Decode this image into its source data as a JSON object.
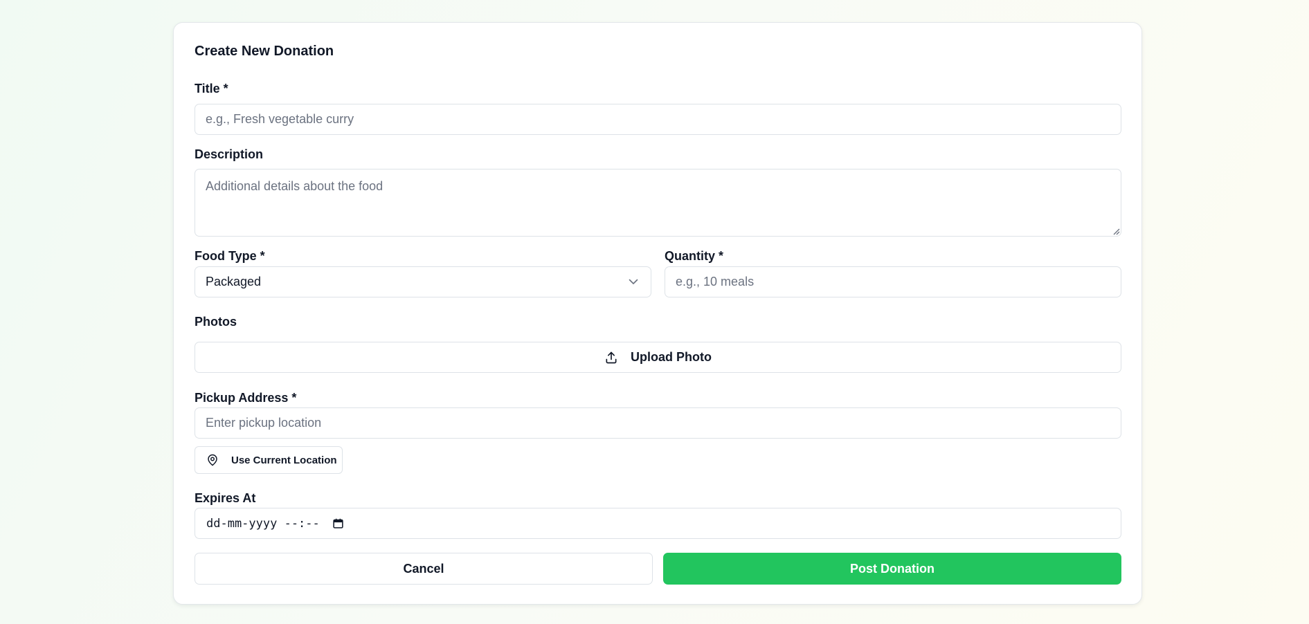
{
  "form": {
    "title": "Create New Donation",
    "title_field": {
      "label": "Title *",
      "placeholder": "e.g., Fresh vegetable curry",
      "value": ""
    },
    "description_field": {
      "label": "Description",
      "placeholder": "Additional details about the food",
      "value": ""
    },
    "food_type_field": {
      "label": "Food Type *",
      "selected": "Packaged",
      "icon": "chevron-down-icon"
    },
    "quantity_field": {
      "label": "Quantity *",
      "placeholder": "e.g., 10 meals",
      "value": ""
    },
    "photos": {
      "label": "Photos",
      "upload_label": "Upload Photo",
      "icon": "upload-icon"
    },
    "pickup_address": {
      "label": "Pickup Address *",
      "placeholder": "Enter pickup location",
      "value": "",
      "location_button_label": "Use Current Location",
      "location_icon": "map-pin-icon"
    },
    "expires_at": {
      "label": "Expires At",
      "display": "dd-mm-yyyy --:--",
      "icon": "calendar-icon"
    },
    "actions": {
      "cancel_label": "Cancel",
      "submit_label": "Post Donation"
    }
  },
  "colors": {
    "accent": "#22c55e",
    "border": "#dde2e7",
    "text": "#111827",
    "placeholder": "#6b7280"
  }
}
